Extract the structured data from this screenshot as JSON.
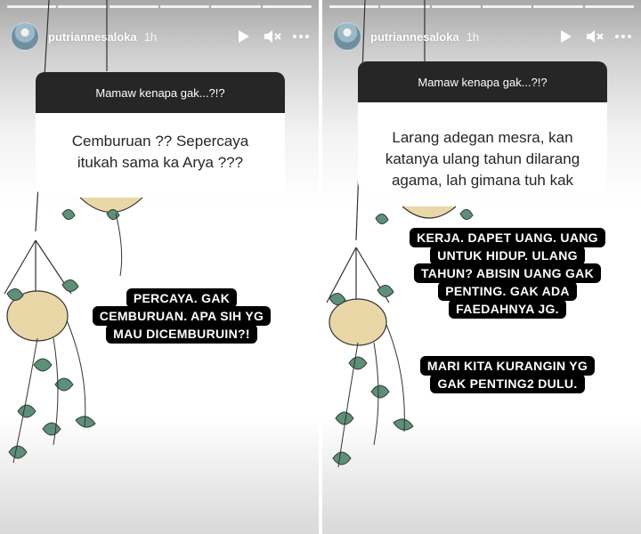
{
  "stories": [
    {
      "username": "putriannesaloka",
      "time": "1h",
      "question_header": "Mamaw kenapa gak...?!?",
      "question_lines": [
        "Cemburuan ?? Sepercaya",
        "itukah sama ka Arya ???"
      ],
      "answer_lines": [
        "PERCAYA. GAK",
        "CEMBURUAN. APA SIH YG",
        "MAU DICEMBURUIN?!"
      ]
    },
    {
      "username": "putriannesaloka",
      "time": "1h",
      "question_header": "Mamaw kenapa gak...?!?",
      "question_lines": [
        "Larang adegan mesra, kan",
        "katanya ulang tahun dilarang",
        "agama, lah gimana tuh kak"
      ],
      "answer_lines": [
        "KERJA. DAPET UANG. UANG",
        "UNTUK HIDUP. ULANG",
        "TAHUN? ABISIN UANG GAK",
        "PENTING. GAK ADA",
        "FAEDAHNYA JG."
      ],
      "answer2_lines": [
        "MARI KITA KURANGIN YG",
        "GAK PENTING2 DULU."
      ]
    }
  ],
  "icons": {
    "play": "play-icon",
    "mute": "muted-speaker-icon",
    "more": "more-dots-icon"
  },
  "colors": {
    "question_header_bg": "#262626",
    "answer_bg": "#000000",
    "leaf_green": "#5e8f78"
  }
}
